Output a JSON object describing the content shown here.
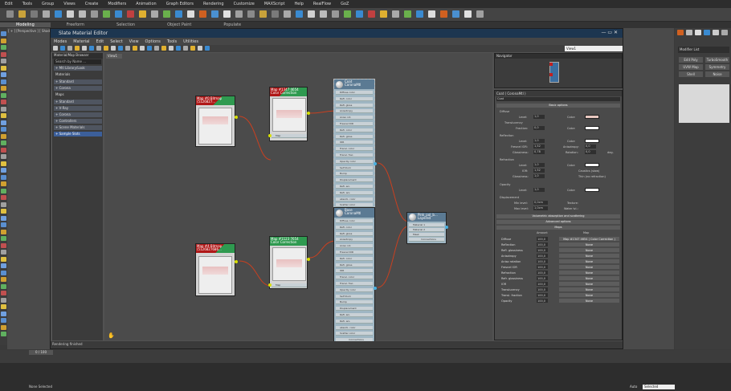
{
  "menubar": {
    "items": [
      "Edit",
      "Tools",
      "Group",
      "Views",
      "Create",
      "Modifiers",
      "Animation",
      "Graph Editors",
      "Rendering",
      "Customize",
      "MAXScript",
      "Help",
      "RealFlow",
      "GoZ"
    ]
  },
  "ribbon": {
    "tabs": [
      "Modeling",
      "Freeform",
      "Selection",
      "Object Paint",
      "Populate"
    ]
  },
  "viewport_label": "[ + ] [Perspective ] [ Shaded ]",
  "sme": {
    "title": "Slate Material Editor",
    "menu": [
      "Modes",
      "Material",
      "Edit",
      "Select",
      "View",
      "Options",
      "Tools",
      "Utilities"
    ],
    "view_dropdown": "View1",
    "view_tab": "View1",
    "browser": {
      "title": "Material/Map Browser",
      "search": "Search by Name ...",
      "rows": [
        {
          "label": "+ Mtl Library/Look",
          "type": "head"
        },
        {
          "label": "Materials",
          "type": "plain"
        },
        {
          "label": "+ Standard",
          "type": "head"
        },
        {
          "label": "+ Corona",
          "type": "head"
        },
        {
          "label": "Maps",
          "type": "plain"
        },
        {
          "label": "+ Standard",
          "type": "head"
        },
        {
          "label": "+ V-Ray",
          "type": "head"
        },
        {
          "label": "+ Corona",
          "type": "head"
        },
        {
          "label": "+ Controllers",
          "type": "head"
        },
        {
          "label": "+ Scene Materials",
          "type": "head"
        },
        {
          "label": "+ Sample Slots",
          "type": "sel"
        }
      ]
    },
    "nodes": {
      "bitmap_top": "Map #0 Bitmap (5126827...",
      "cc_top": "Map #1347 4654\nColor Correction",
      "coat": "Coat\nCoronaMtl",
      "bitmap_bottom": "Map #4 Bitmap (5126827686...",
      "cc_bottom": "Map #1123 7654\nColor Correction",
      "base": "Base\nCoronaMtl",
      "blend": "Pink_pol_b...\nLayered",
      "map_slot": "Map",
      "slots": [
        "Diffuse color",
        "Refl. color",
        "Refl. gloss",
        "Anisotropy",
        "Aniso rot.",
        "Fresnel IOR",
        "Refr. color",
        "Refr. gloss",
        "IOR",
        "Transl. color",
        "Transl. frac.",
        "Opacity color",
        "Self illum",
        "Bump",
        "Displacement",
        "Refl. ani.",
        "Refr. ani.",
        "absorb. color",
        "Scatter color"
      ],
      "more": "Connections",
      "blend_slots": [
        "Material 1",
        "Material 2",
        "Mask"
      ]
    },
    "navigator_title": "Navigator",
    "params": {
      "title": "Coat  ( CoronaMtl )",
      "name_field": "Coat",
      "basic": "Basic options",
      "diffuse": "Diffuse",
      "level": "Level:",
      "level_val": "1,0",
      "color": "Color:",
      "translucency": "Translucency",
      "fraction": "Fraction:",
      "fraction_val": "0,0",
      "reflection": "Reflection",
      "fresnel": "Fresnel IOR:",
      "fresnel_val": "1,52",
      "anisotropy": "Anisotropy:",
      "aniso_val": "0,0",
      "glossiness": "Glossiness:",
      "gloss_val": "0,78",
      "rotation": "Rotation:",
      "rot_val": "0,0",
      "deg": "deg.",
      "refraction": "Refraction",
      "ior": "IOR:",
      "ior_val": "1,52",
      "caustics": "Caustics (slow)",
      "thin": "Thin (no refraction)",
      "opacity": "Opacity",
      "displacement": "Displacement",
      "minlevel": "Min level:",
      "minval": "0,0cm",
      "maxlevel": "Max level:",
      "maxval": "1,0cm",
      "texture": "Texture:",
      "water": "Water lvl.:",
      "volumetric": "Volumetric absorption and scattering",
      "advanced": "Advanced options",
      "maps": "Maps",
      "amount": "Amount",
      "map_col": "Map",
      "map_rows": [
        {
          "label": "Diffuse",
          "amount": "100,0",
          "map": "Map #1347 4654  ( Color Correction )"
        },
        {
          "label": "Reflection",
          "amount": "100,0",
          "map": "None"
        },
        {
          "label": "Refl. glossiness",
          "amount": "100,0",
          "map": "None"
        },
        {
          "label": "Anisotropy",
          "amount": "100,0",
          "map": "None"
        },
        {
          "label": "Aniso rotation",
          "amount": "100,0",
          "map": "None"
        },
        {
          "label": "Fresnel IOR",
          "amount": "100,0",
          "map": "None"
        },
        {
          "label": "Refraction",
          "amount": "100,0",
          "map": "None"
        },
        {
          "label": "Refr. glossiness",
          "amount": "100,0",
          "map": "None"
        },
        {
          "label": "IOR",
          "amount": "100,0",
          "map": "None"
        },
        {
          "label": "Translucency",
          "amount": "100,0",
          "map": "None"
        },
        {
          "label": "Transl. fraction",
          "amount": "100,0",
          "map": "None"
        },
        {
          "label": "Opacity",
          "amount": "100,0",
          "map": "None"
        }
      ]
    },
    "status": "Rendering finished",
    "zoom": "62%"
  },
  "right_panel": {
    "modifier_list": "Modifier List",
    "buttons": [
      "Edit Poly",
      "TurboSmooth",
      "UVW Map",
      "Symmetry",
      "Shell",
      "Noise"
    ]
  },
  "timeline": {
    "frame": "0 / 100"
  },
  "statusbar": {
    "message": "None Selected",
    "auto": "Auto",
    "selected": "Selected"
  },
  "colors": {
    "accent": "#1d3650",
    "coat_swatch": "#e8c8c0",
    "wire": "#d04020"
  }
}
